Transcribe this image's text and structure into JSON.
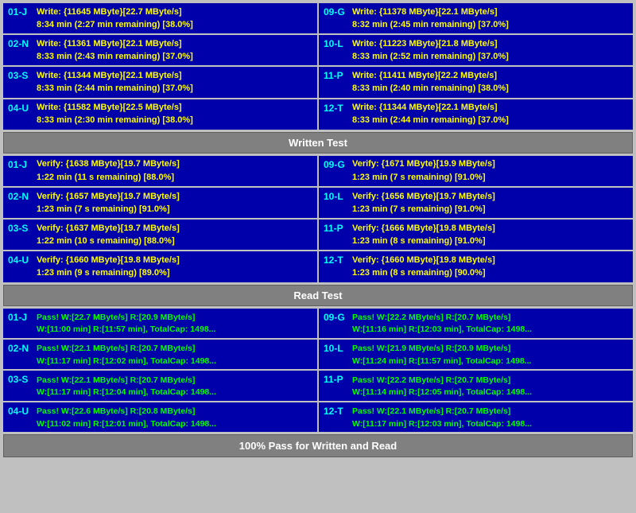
{
  "sections": {
    "written_test": {
      "label": "Written Test",
      "write_rows": [
        {
          "left": {
            "id": "01-J",
            "line1": "Write: {11645 MByte}[22.7 MByte/s]",
            "line2": "8:34 min (2:27 min remaining)  [38.0%]"
          },
          "right": {
            "id": "09-G",
            "line1": "Write: {11378 MByte}[22.1 MByte/s]",
            "line2": "8:32 min (2:45 min remaining)  [37.0%]"
          }
        },
        {
          "left": {
            "id": "02-N",
            "line1": "Write: {11361 MByte}[22.1 MByte/s]",
            "line2": "8:33 min (2:43 min remaining)  [37.0%]"
          },
          "right": {
            "id": "10-L",
            "line1": "Write: {11223 MByte}[21.8 MByte/s]",
            "line2": "8:33 min (2:52 min remaining)  [37.0%]"
          }
        },
        {
          "left": {
            "id": "03-S",
            "line1": "Write: {11344 MByte}[22.1 MByte/s]",
            "line2": "8:33 min (2:44 min remaining)  [37.0%]"
          },
          "right": {
            "id": "11-P",
            "line1": "Write: {11411 MByte}[22.2 MByte/s]",
            "line2": "8:33 min (2:40 min remaining)  [38.0%]"
          }
        },
        {
          "left": {
            "id": "04-U",
            "line1": "Write: {11582 MByte}[22.5 MByte/s]",
            "line2": "8:33 min (2:30 min remaining)  [38.0%]"
          },
          "right": {
            "id": "12-T",
            "line1": "Write: {11344 MByte}[22.1 MByte/s]",
            "line2": "8:33 min (2:44 min remaining)  [37.0%]"
          }
        }
      ]
    },
    "verify_rows": [
      {
        "left": {
          "id": "01-J",
          "line1": "Verify: {1638 MByte}[19.7 MByte/s]",
          "line2": "1:22 min (11 s remaining)  [88.0%]"
        },
        "right": {
          "id": "09-G",
          "line1": "Verify: {1671 MByte}[19.9 MByte/s]",
          "line2": "1:23 min (7 s remaining)  [91.0%]"
        }
      },
      {
        "left": {
          "id": "02-N",
          "line1": "Verify: {1657 MByte}[19.7 MByte/s]",
          "line2": "1:23 min (7 s remaining)  [91.0%]"
        },
        "right": {
          "id": "10-L",
          "line1": "Verify: {1656 MByte}[19.7 MByte/s]",
          "line2": "1:23 min (7 s remaining)  [91.0%]"
        }
      },
      {
        "left": {
          "id": "03-S",
          "line1": "Verify: {1637 MByte}[19.7 MByte/s]",
          "line2": "1:22 min (10 s remaining)  [88.0%]"
        },
        "right": {
          "id": "11-P",
          "line1": "Verify: {1666 MByte}[19.8 MByte/s]",
          "line2": "1:23 min (8 s remaining)  [91.0%]"
        }
      },
      {
        "left": {
          "id": "04-U",
          "line1": "Verify: {1660 MByte}[19.8 MByte/s]",
          "line2": "1:23 min (9 s remaining)  [89.0%]"
        },
        "right": {
          "id": "12-T",
          "line1": "Verify: {1660 MByte}[19.8 MByte/s]",
          "line2": "1:23 min (8 s remaining)  [90.0%]"
        }
      }
    ],
    "read_test": {
      "label": "Read Test",
      "rows": [
        {
          "left": {
            "id": "01-J",
            "line1": "Pass! W:[22.7 MByte/s] R:[20.9 MByte/s]",
            "line2": "W:[11:00 min] R:[11:57 min], TotalCap: 1498..."
          },
          "right": {
            "id": "09-G",
            "line1": "Pass! W:[22.2 MByte/s] R:[20.7 MByte/s]",
            "line2": "W:[11:16 min] R:[12:03 min], TotalCap: 1498..."
          }
        },
        {
          "left": {
            "id": "02-N",
            "line1": "Pass! W:[22.1 MByte/s] R:[20.7 MByte/s]",
            "line2": "W:[11:17 min] R:[12:02 min], TotalCap: 1498..."
          },
          "right": {
            "id": "10-L",
            "line1": "Pass! W:[21.9 MByte/s] R:[20.9 MByte/s]",
            "line2": "W:[11:24 min] R:[11:57 min], TotalCap: 1498..."
          }
        },
        {
          "left": {
            "id": "03-S",
            "line1": "Pass! W:[22.1 MByte/s] R:[20.7 MByte/s]",
            "line2": "W:[11:17 min] R:[12:04 min], TotalCap: 1498..."
          },
          "right": {
            "id": "11-P",
            "line1": "Pass! W:[22.2 MByte/s] R:[20.7 MByte/s]",
            "line2": "W:[11:14 min] R:[12:05 min], TotalCap: 1498..."
          }
        },
        {
          "left": {
            "id": "04-U",
            "line1": "Pass! W:[22.6 MByte/s] R:[20.8 MByte/s]",
            "line2": "W:[11:02 min] R:[12:01 min], TotalCap: 1498..."
          },
          "right": {
            "id": "12-T",
            "line1": "Pass! W:[22.1 MByte/s] R:[20.7 MByte/s]",
            "line2": "W:[11:17 min] R:[12:03 min], TotalCap: 1498..."
          }
        }
      ]
    },
    "footer": "100% Pass for Written and Read"
  }
}
